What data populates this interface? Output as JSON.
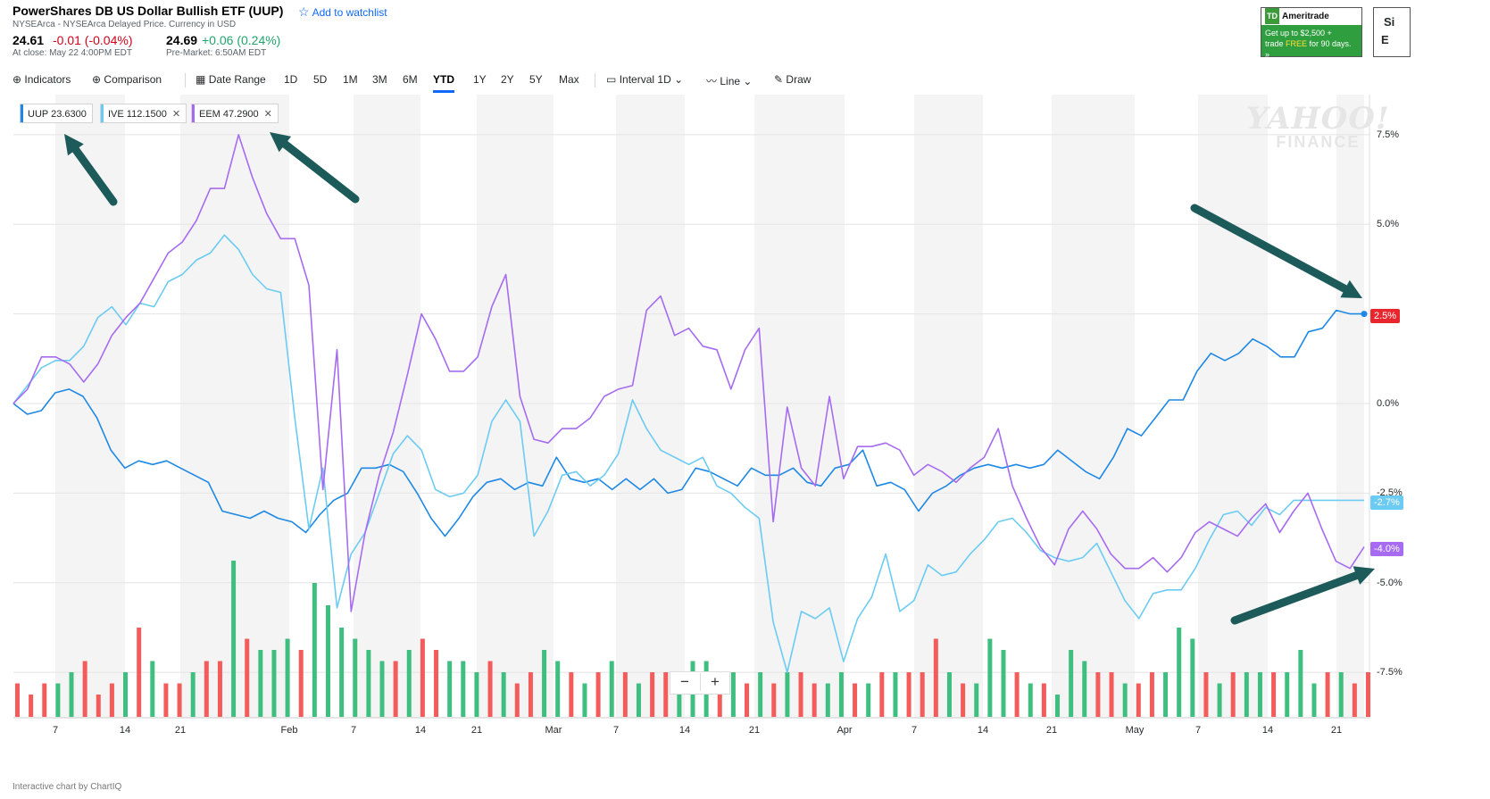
{
  "header": {
    "title": "PowerShares DB US Dollar Bullish ETF (UUP)",
    "watchlist_label": "Add to watchlist",
    "subtitle": "NYSEArca - NYSEArca Delayed Price. Currency in USD",
    "close_price": "24.61",
    "close_change": "-0.01 (-0.04%)",
    "close_time": "At close: May 22 4:00PM EDT",
    "pre_price": "24.69",
    "pre_change": "+0.06 (0.24%)",
    "pre_time": "Pre-Market: 6:50AM EDT"
  },
  "ad": {
    "brand": "Ameritrade",
    "logo": "TD",
    "line1": "Get up to $2,500 +",
    "line2_prefix": "trade ",
    "line2_free": "FREE",
    "line2_suffix": " for 90 days. »",
    "side_top": "Si",
    "side_bottom": "E"
  },
  "toolbar": {
    "indicators": "Indicators",
    "comparison": "Comparison",
    "date_range": "Date Range",
    "ranges": [
      "1D",
      "5D",
      "1M",
      "3M",
      "6M",
      "YTD",
      "1Y",
      "2Y",
      "5Y",
      "Max"
    ],
    "active_range": "YTD",
    "interval": "Interval",
    "interval_value": "1D",
    "line": "Line",
    "draw": "Draw"
  },
  "chips": [
    {
      "symbol": "UUP",
      "value": "23.6300",
      "color": "#1e88e5",
      "closable": false
    },
    {
      "symbol": "IVE",
      "value": "112.1500",
      "color": "#6ccbf2",
      "closable": true
    },
    {
      "symbol": "EEM",
      "value": "47.2900",
      "color": "#a66bf0",
      "closable": true
    }
  ],
  "watermark": {
    "line1": "YAHOO!",
    "line2": "FINANCE"
  },
  "zoom": {
    "minus": "−",
    "plus": "+"
  },
  "footer": "Interactive chart by ChartIQ",
  "chart_data": {
    "type": "line",
    "y_unit": "% change",
    "ylim": [
      -8.5,
      7.6
    ],
    "yticks": [
      "7.5%",
      "5.0%",
      "2.5%",
      "0.0%",
      "-2.5%",
      "-5.0%",
      "-7.5%"
    ],
    "ytick_values": [
      7.5,
      5.0,
      2.5,
      0.0,
      -2.5,
      -5.0,
      -7.5
    ],
    "xticks": [
      "7",
      "14",
      "21",
      "Feb",
      "7",
      "14",
      "21",
      "Mar",
      "7",
      "14",
      "21",
      "Apr",
      "7",
      "14",
      "21",
      "May",
      "7",
      "14",
      "21"
    ],
    "n_points": 97,
    "end_labels": [
      {
        "series": "UUP",
        "text": "2.5%",
        "color": "#e8262e",
        "value": 2.5
      },
      {
        "series": "IVE",
        "text": "-2.7%",
        "color": "#6ccbf2",
        "value": -2.7
      },
      {
        "series": "EEM",
        "text": "-4.0%",
        "color": "#a66bf0",
        "value": -4.0
      }
    ],
    "series": [
      {
        "name": "UUP",
        "color": "#1e88e5",
        "values": [
          0.0,
          -0.3,
          -0.2,
          0.3,
          0.4,
          0.2,
          -0.4,
          -1.3,
          -1.8,
          -1.6,
          -1.7,
          -1.6,
          -1.8,
          -2.0,
          -2.2,
          -3.0,
          -3.1,
          -3.2,
          -3.0,
          -3.2,
          -3.3,
          -3.6,
          -3.1,
          -2.7,
          -2.5,
          -1.8,
          -1.8,
          -1.7,
          -1.9,
          -2.5,
          -3.2,
          -3.7,
          -3.2,
          -2.6,
          -2.2,
          -2.1,
          -2.4,
          -2.2,
          -2.3,
          -1.5,
          -2.1,
          -2.2,
          -2.1,
          -2.4,
          -2.1,
          -2.4,
          -2.1,
          -2.5,
          -2.4,
          -1.8,
          -1.9,
          -2.1,
          -2.3,
          -1.8,
          -2.0,
          -2.0,
          -1.8,
          -2.2,
          -2.3,
          -1.8,
          -1.7,
          -1.3,
          -2.3,
          -2.2,
          -2.4,
          -3.0,
          -2.5,
          -2.3,
          -2.0,
          -1.8,
          -1.7,
          -1.8,
          -1.7,
          -1.8,
          -1.7,
          -1.3,
          -1.6,
          -1.9,
          -2.1,
          -1.5,
          -0.7,
          -0.9,
          -0.4,
          0.1,
          0.1,
          0.9,
          1.4,
          1.2,
          1.4,
          1.8,
          1.6,
          1.3,
          1.3,
          2.0,
          2.1,
          2.6,
          2.5,
          2.5
        ]
      },
      {
        "name": "IVE",
        "color": "#6ccbf2",
        "values": [
          0.0,
          0.5,
          1.0,
          1.2,
          1.2,
          1.6,
          2.4,
          2.7,
          2.2,
          2.8,
          2.7,
          3.4,
          3.6,
          4.0,
          4.2,
          4.7,
          4.3,
          3.6,
          3.2,
          3.1,
          -0.4,
          -3.5,
          -1.8,
          -5.7,
          -4.2,
          -3.6,
          -2.5,
          -1.4,
          -0.9,
          -1.3,
          -2.4,
          -2.6,
          -2.5,
          -2.0,
          -0.5,
          0.1,
          -0.5,
          -3.7,
          -3.0,
          -2.0,
          -1.9,
          -2.3,
          -2.0,
          -1.4,
          0.1,
          -0.7,
          -1.3,
          -1.5,
          -1.7,
          -1.5,
          -2.3,
          -2.5,
          -2.9,
          -3.2,
          -6.1,
          -7.5,
          -5.8,
          -6.0,
          -5.7,
          -7.2,
          -6.0,
          -5.4,
          -4.2,
          -5.8,
          -5.5,
          -4.5,
          -4.8,
          -4.7,
          -4.2,
          -3.8,
          -3.3,
          -3.2,
          -3.6,
          -4.1,
          -4.3,
          -4.4,
          -4.3,
          -3.9,
          -4.7,
          -5.5,
          -6.0,
          -5.3,
          -5.2,
          -5.2,
          -4.6,
          -3.8,
          -3.1,
          -3.0,
          -3.4,
          -2.9,
          -3.1,
          -2.7,
          -2.7,
          -2.7,
          -2.7,
          -2.7,
          -2.7
        ]
      },
      {
        "name": "EEM",
        "color": "#a66bf0",
        "values": [
          0.0,
          0.4,
          1.3,
          1.3,
          1.1,
          0.6,
          1.1,
          1.9,
          2.4,
          2.8,
          3.5,
          4.2,
          4.5,
          5.1,
          6.0,
          6.0,
          7.5,
          6.3,
          5.3,
          4.6,
          4.6,
          3.3,
          -2.4,
          1.5,
          -5.8,
          -3.6,
          -2.0,
          -0.8,
          0.8,
          2.5,
          1.8,
          0.9,
          0.9,
          1.3,
          2.7,
          3.6,
          0.2,
          -1.0,
          -1.1,
          -0.7,
          -0.7,
          -0.4,
          0.2,
          0.4,
          0.5,
          2.6,
          3.0,
          1.9,
          2.1,
          1.6,
          1.5,
          0.4,
          1.5,
          2.1,
          -3.3,
          -0.1,
          -1.8,
          -2.3,
          0.2,
          -2.1,
          -1.2,
          -1.2,
          -1.1,
          -1.3,
          -2.0,
          -1.7,
          -1.9,
          -2.2,
          -1.8,
          -1.5,
          -0.7,
          -2.3,
          -3.2,
          -4.0,
          -4.5,
          -3.5,
          -3.0,
          -3.5,
          -4.2,
          -4.6,
          -4.6,
          -4.3,
          -4.7,
          -4.3,
          -3.6,
          -3.3,
          -3.5,
          -3.7,
          -3.2,
          -2.8,
          -3.6,
          -3.0,
          -2.5,
          -3.5,
          -4.4,
          -4.6,
          -4.0
        ]
      }
    ],
    "volume": {
      "values": [
        3,
        2,
        3,
        3,
        4,
        5,
        2,
        3,
        4,
        8,
        5,
        3,
        3,
        4,
        5,
        5,
        14,
        7,
        6,
        6,
        7,
        6,
        12,
        10,
        8,
        7,
        6,
        5,
        5,
        6,
        7,
        6,
        5,
        5,
        4,
        5,
        4,
        3,
        4,
        6,
        5,
        4,
        3,
        4,
        5,
        4,
        3,
        4,
        4,
        3,
        5,
        5,
        3,
        4,
        3,
        4,
        3,
        4,
        4,
        3,
        3,
        4,
        3,
        3,
        4,
        4,
        4,
        4,
        7,
        4,
        3,
        3,
        7,
        6,
        4,
        3,
        3,
        2,
        6,
        5,
        4,
        4,
        3,
        3,
        4,
        4,
        8,
        7,
        4,
        3,
        4,
        4,
        4,
        4,
        4,
        6,
        3,
        4,
        4,
        3,
        4
      ],
      "up": [
        0,
        0,
        0,
        1,
        1,
        0,
        0,
        0,
        1,
        0,
        1,
        0,
        0,
        1,
        0,
        0,
        1,
        0,
        1,
        1,
        1,
        0,
        1,
        1,
        1,
        1,
        1,
        1,
        0,
        1,
        0,
        0,
        1,
        1,
        1,
        0,
        1,
        0,
        0,
        1,
        1,
        0,
        1,
        0,
        1,
        0,
        1,
        0,
        0,
        1,
        1,
        1,
        0,
        1,
        0,
        1,
        0,
        1,
        0,
        0,
        1,
        1,
        0,
        1,
        0,
        1,
        0,
        0,
        0,
        1,
        0,
        1,
        1,
        1,
        0,
        1,
        0,
        1,
        1,
        1,
        0,
        0,
        1,
        0,
        0,
        1,
        1,
        1,
        0,
        1,
        0,
        1,
        1,
        0,
        1,
        1,
        1,
        0,
        1,
        0,
        0
      ],
      "up_color": "#3fbf7f",
      "down_color": "#f45b5b"
    }
  }
}
